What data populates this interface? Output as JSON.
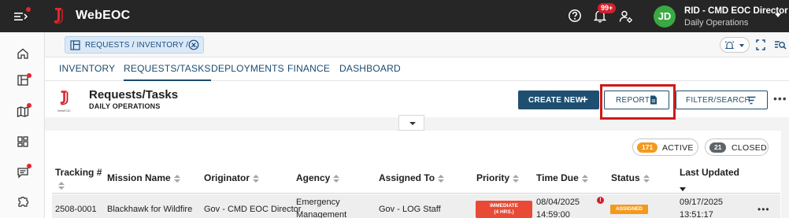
{
  "app": {
    "title": "WebEOC",
    "logo_caption": "WebEOC"
  },
  "header": {
    "notifications_badge": "99+",
    "user": {
      "initials": "JD",
      "name": "RID - CMD EOC Director",
      "subtitle": "Daily Operations"
    }
  },
  "tabstrip": {
    "open_tab": "REQUESTS / INVENTORY / ..."
  },
  "nav": {
    "tabs": [
      {
        "label": "INVENTORY"
      },
      {
        "label": "REQUESTS/TASKS"
      },
      {
        "label": "DEPLOYMENTS"
      },
      {
        "label": "FINANCE"
      },
      {
        "label": "DASHBOARD"
      }
    ],
    "active": "REQUESTS/TASKS"
  },
  "page": {
    "title": "Requests/Tasks",
    "subtitle": "DAILY OPERATIONS",
    "buttons": {
      "create": "CREATE NEW",
      "report": "REPORT",
      "filter": "FILTER/SEARCH"
    }
  },
  "filters": {
    "active": {
      "count": "171",
      "label": "ACTIVE"
    },
    "closed": {
      "count": "21",
      "label": "CLOSED"
    }
  },
  "table": {
    "columns": [
      "Tracking #",
      "Mission Name",
      "Originator",
      "Agency",
      "Assigned To",
      "Priority",
      "Time Due",
      "Status",
      "Last Updated"
    ],
    "rows": [
      {
        "tracking": "2508-0001",
        "mission": "Blackhawk for Wildfire",
        "originator": "Gov - CMD EOC Director",
        "agency_line1": "Emergency",
        "agency_line2": "Management",
        "assigned_to": "Gov - LOG Staff",
        "priority_line1": "IMMEDIATE",
        "priority_line2": "(4 HRS.)",
        "overdue_marker": "!",
        "time_due_date": "08/04/2025",
        "time_due_time": "14:59:00",
        "status": "ASSIGNED",
        "updated_date": "09/17/2025",
        "updated_time": "13:51:17"
      }
    ]
  },
  "colors": {
    "topbar": "#262626",
    "accent": "#1f4f70",
    "alert_red": "#d3202b",
    "active_orange": "#f39a1e",
    "priority_red": "#e84a36",
    "avatar_green": "#3aa843"
  }
}
